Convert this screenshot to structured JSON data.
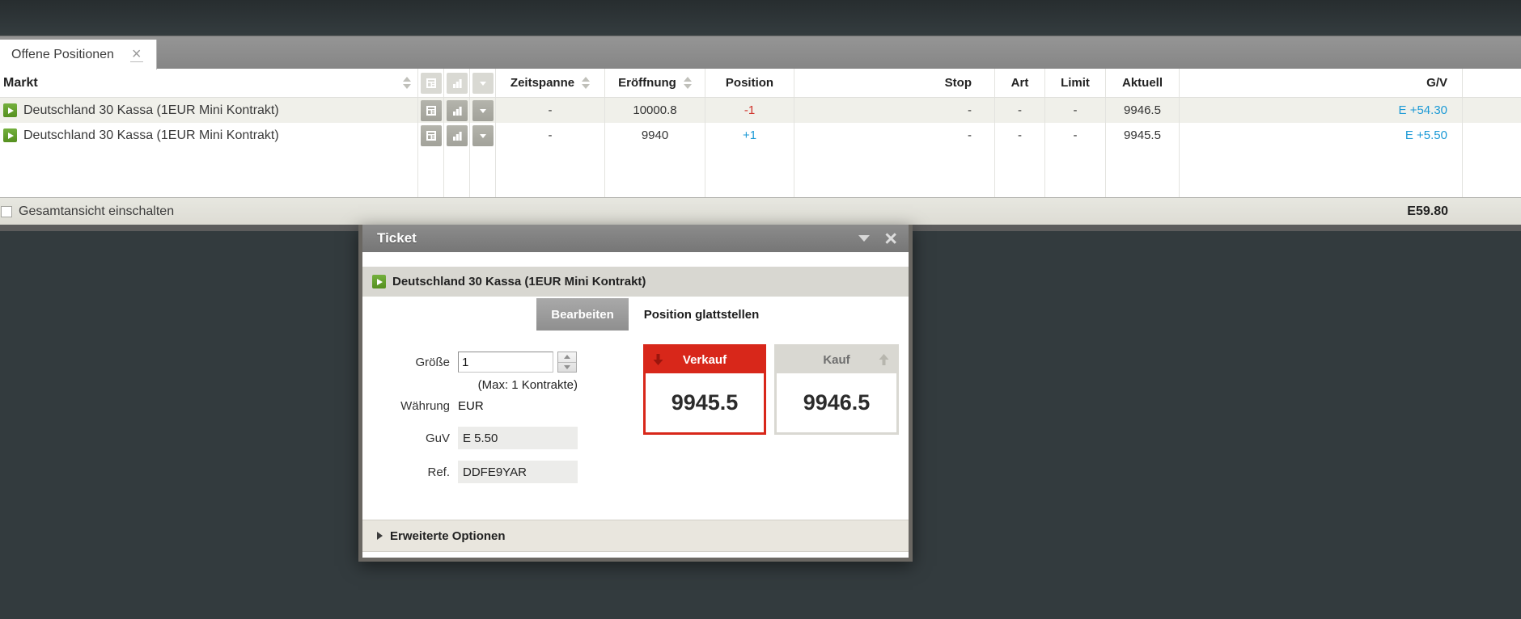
{
  "panel": {
    "tab_label": "Offene Positionen",
    "tab_close_glyph": "×"
  },
  "table": {
    "columns": {
      "markt": "Markt",
      "zeitspanne": "Zeitspanne",
      "eroeffnung": "Eröffnung",
      "position": "Position",
      "stop": "Stop",
      "art": "Art",
      "limit": "Limit",
      "aktuell": "Aktuell",
      "gv": "G/V"
    },
    "rows": [
      {
        "market": "Deutschland 30 Kassa (1EUR Mini Kontrakt)",
        "zeitspanne": "-",
        "eroeffnung": "10000.8",
        "position": "-1",
        "stop": "-",
        "art": "-",
        "limit": "-",
        "aktuell": "9946.5",
        "gv": "E +54.30"
      },
      {
        "market": "Deutschland 30 Kassa (1EUR Mini Kontrakt)",
        "zeitspanne": "-",
        "eroeffnung": "9940",
        "position": "+1",
        "stop": "-",
        "art": "-",
        "limit": "-",
        "aktuell": "9945.5",
        "gv": "E +5.50"
      }
    ],
    "footer": {
      "toggle_label": "Gesamtansicht einschalten",
      "total_gv": "E59.80"
    }
  },
  "ticket": {
    "title": "Ticket",
    "close_glyph": "×",
    "instrument": "Deutschland 30 Kassa (1EUR Mini Kontrakt)",
    "tabs": [
      {
        "label": "Bearbeiten",
        "active": false
      },
      {
        "label": "Position glattstellen",
        "active": true
      }
    ],
    "form": {
      "size_label": "Größe",
      "size_value": "1",
      "max_hint": "(Max: 1 Kontrakte)",
      "currency_label": "Währung",
      "currency_value": "EUR",
      "pnl_label": "GuV",
      "pnl_value": "E 5.50",
      "ref_label": "Ref.",
      "ref_value": "DDFE9YAR"
    },
    "sell": {
      "label": "Verkauf",
      "price": "9945.5"
    },
    "buy": {
      "label": "Kauf",
      "price": "9946.5"
    },
    "advanced_label": "Erweiterte Optionen"
  },
  "icons": {
    "market-play-icon": "green square with white right triangle",
    "details-icon": "newspaper/details sheet",
    "chart-icon": "ascending bar chart",
    "row-menu-icon": "down triangle button",
    "sort-icon": "stacked up/down triangles",
    "sell-arrow-icon": "thick down arrow",
    "buy-arrow-icon": "thick up arrow"
  },
  "colors": {
    "sell_red": "#d8271a",
    "loss_red": "#d0342c",
    "profit_blue": "#1c9ad6",
    "market_green": "#5e9a2b",
    "titlebar_gray": "#7e7e7e",
    "page_background": "#333b3e"
  }
}
